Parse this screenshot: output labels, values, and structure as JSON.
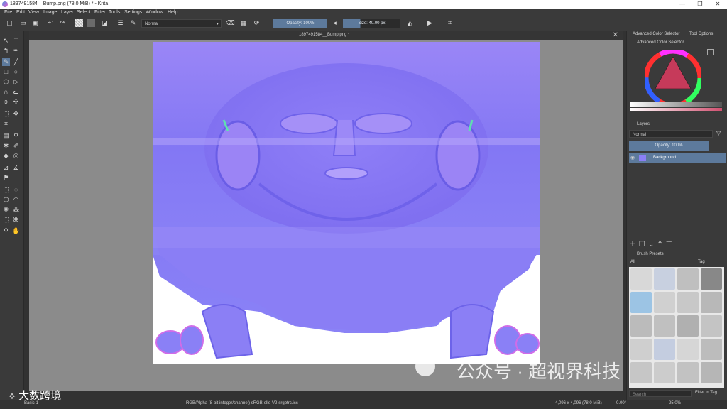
{
  "window": {
    "title": "1897491584__Bump.png (78.0 MiB)  * - Krita"
  },
  "menu": [
    "File",
    "Edit",
    "View",
    "Image",
    "Layer",
    "Select",
    "Filter",
    "Tools",
    "Settings",
    "Window",
    "Help"
  ],
  "toolbar": {
    "blend_mode": "Normal",
    "opacity_label": "Opacity: 100%",
    "size_label": "Size: 40.00 px"
  },
  "document": {
    "tab_title": "1897491584__Bump.png *"
  },
  "docker": {
    "tabs": [
      "Advanced Color Selector",
      "Tool Options"
    ],
    "color_selector_title": "Advanced Color Selector",
    "layers_title": "Layers",
    "layers_blend": "Normal",
    "layers_opacity": "Opacity: 100%",
    "layer_name": "Background",
    "brush_presets_title": "Brush Presets",
    "brush_filter": "All",
    "tag_label": "Tag",
    "search_placeholder": "Search",
    "filter_in_tag": "Filter in Tag"
  },
  "status": {
    "brush_name": "Basic-1",
    "color_info": "RGB/Alpha (8-bit integer/channel)  sRGB-elle-V2-srgbtrc.icc",
    "dimensions": "4,096 x 4,096 (78.0 MiB)",
    "rotation": "0.00°",
    "zoom": "25.0%"
  },
  "watermark": {
    "text": "公众号 · 超视界科技",
    "corner": "大数跨境"
  },
  "colors": {
    "normal_map": "#8b7ff5",
    "accent": "#5d7a9c"
  }
}
